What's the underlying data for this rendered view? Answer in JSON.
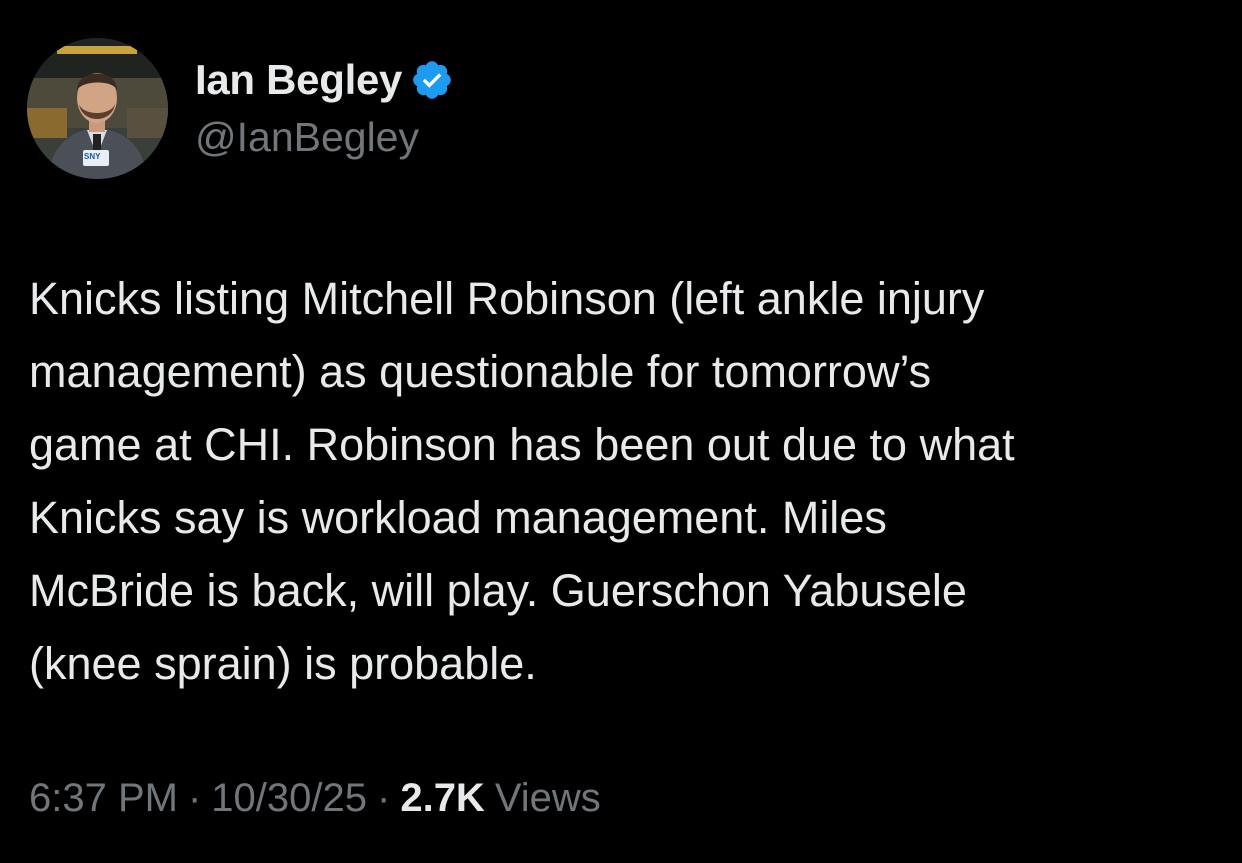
{
  "author": {
    "display_name": "Ian Begley",
    "handle": "@IanBegley",
    "verified_icon": "verified-badge-icon",
    "avatar_icon": "profile-photo",
    "avatar_logo_text": "SNY"
  },
  "tweet": {
    "lines": [
      "Knicks listing Mitchell Robinson (left ankle injury",
      "management) as questionable for tomorrow’s",
      "game at CHI. Robinson has been out due to what",
      "Knicks say is workload management. Miles",
      "McBride is back, will play. Guerschon Yabusele",
      "(knee sprain) is probable."
    ]
  },
  "meta": {
    "time": "6:37 PM",
    "separator": "·",
    "date": "10/30/25",
    "views_count": "2.7K",
    "views_label": "Views"
  },
  "colors": {
    "background": "#000000",
    "primary_text": "#e7e9ea",
    "secondary_text": "#71767b",
    "verified_blue": "#1d9bf0"
  }
}
